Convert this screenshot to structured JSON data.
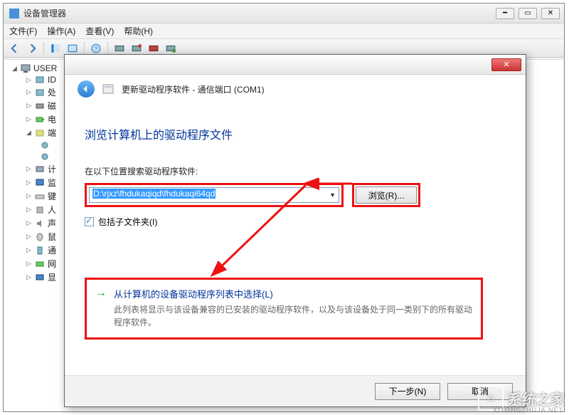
{
  "window": {
    "title": "设备管理器",
    "minimize_glyph": "━",
    "maximize_glyph": "▭",
    "close_glyph": "✕"
  },
  "menu": {
    "file": "文件(F)",
    "action": "操作(A)",
    "view": "查看(V)",
    "help": "帮助(H)"
  },
  "tree": {
    "root": "USER",
    "items": [
      {
        "label": "ID",
        "collapsed": true
      },
      {
        "label": "处"
      },
      {
        "label": "磁"
      },
      {
        "label": "电"
      },
      {
        "label": "端",
        "expanded": true
      },
      {
        "label": "计"
      },
      {
        "label": "监"
      },
      {
        "label": "键"
      },
      {
        "label": "人"
      },
      {
        "label": "声"
      },
      {
        "label": "鼠"
      },
      {
        "label": "通"
      },
      {
        "label": "网"
      },
      {
        "label": "显"
      }
    ]
  },
  "dialog": {
    "close_glyph": "✕",
    "header": "更新驱动程序软件 - 通信端口 (COM1)",
    "title": "浏览计算机上的驱动程序文件",
    "search_label": "在以下位置搜索驱动程序软件:",
    "path_value": "D:\\rjxz\\fhdukaqiqd\\fhdukaqi64qd",
    "dropdown_glyph": "▼",
    "browse_label": "浏览(R)...",
    "include_sub_label": "包括子文件夹(I)",
    "pick_arrow": "→",
    "pick_title": "从计算机的设备驱动程序列表中选择(L)",
    "pick_desc": "此列表将显示与该设备兼容的已安装的驱动程序软件，以及与该设备处于同一类别下的所有驱动程序软件。",
    "next_label": "下一步(N)",
    "cancel_label": "取消"
  },
  "watermark": {
    "brand": "系统之家",
    "url": "XITONGZHUJA.NET"
  }
}
